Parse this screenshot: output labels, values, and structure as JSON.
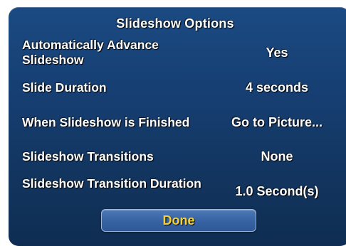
{
  "dialog": {
    "title": "Slideshow Options",
    "rows": [
      {
        "label": "Automatically Advance Slideshow",
        "value": "Yes"
      },
      {
        "label": "Slide Duration",
        "value": "4 seconds"
      },
      {
        "label": "When Slideshow is Finished",
        "value": "Go to Picture..."
      },
      {
        "label": "Slideshow Transitions",
        "value": "None"
      },
      {
        "label": "Slideshow Transition Duration",
        "value": "1.0 Second(s)"
      }
    ],
    "done_label": "Done"
  },
  "colors": {
    "panel": "#163f73",
    "text": "#ffffff",
    "done_text": "#f4d23a",
    "button": "#3a65a6"
  }
}
